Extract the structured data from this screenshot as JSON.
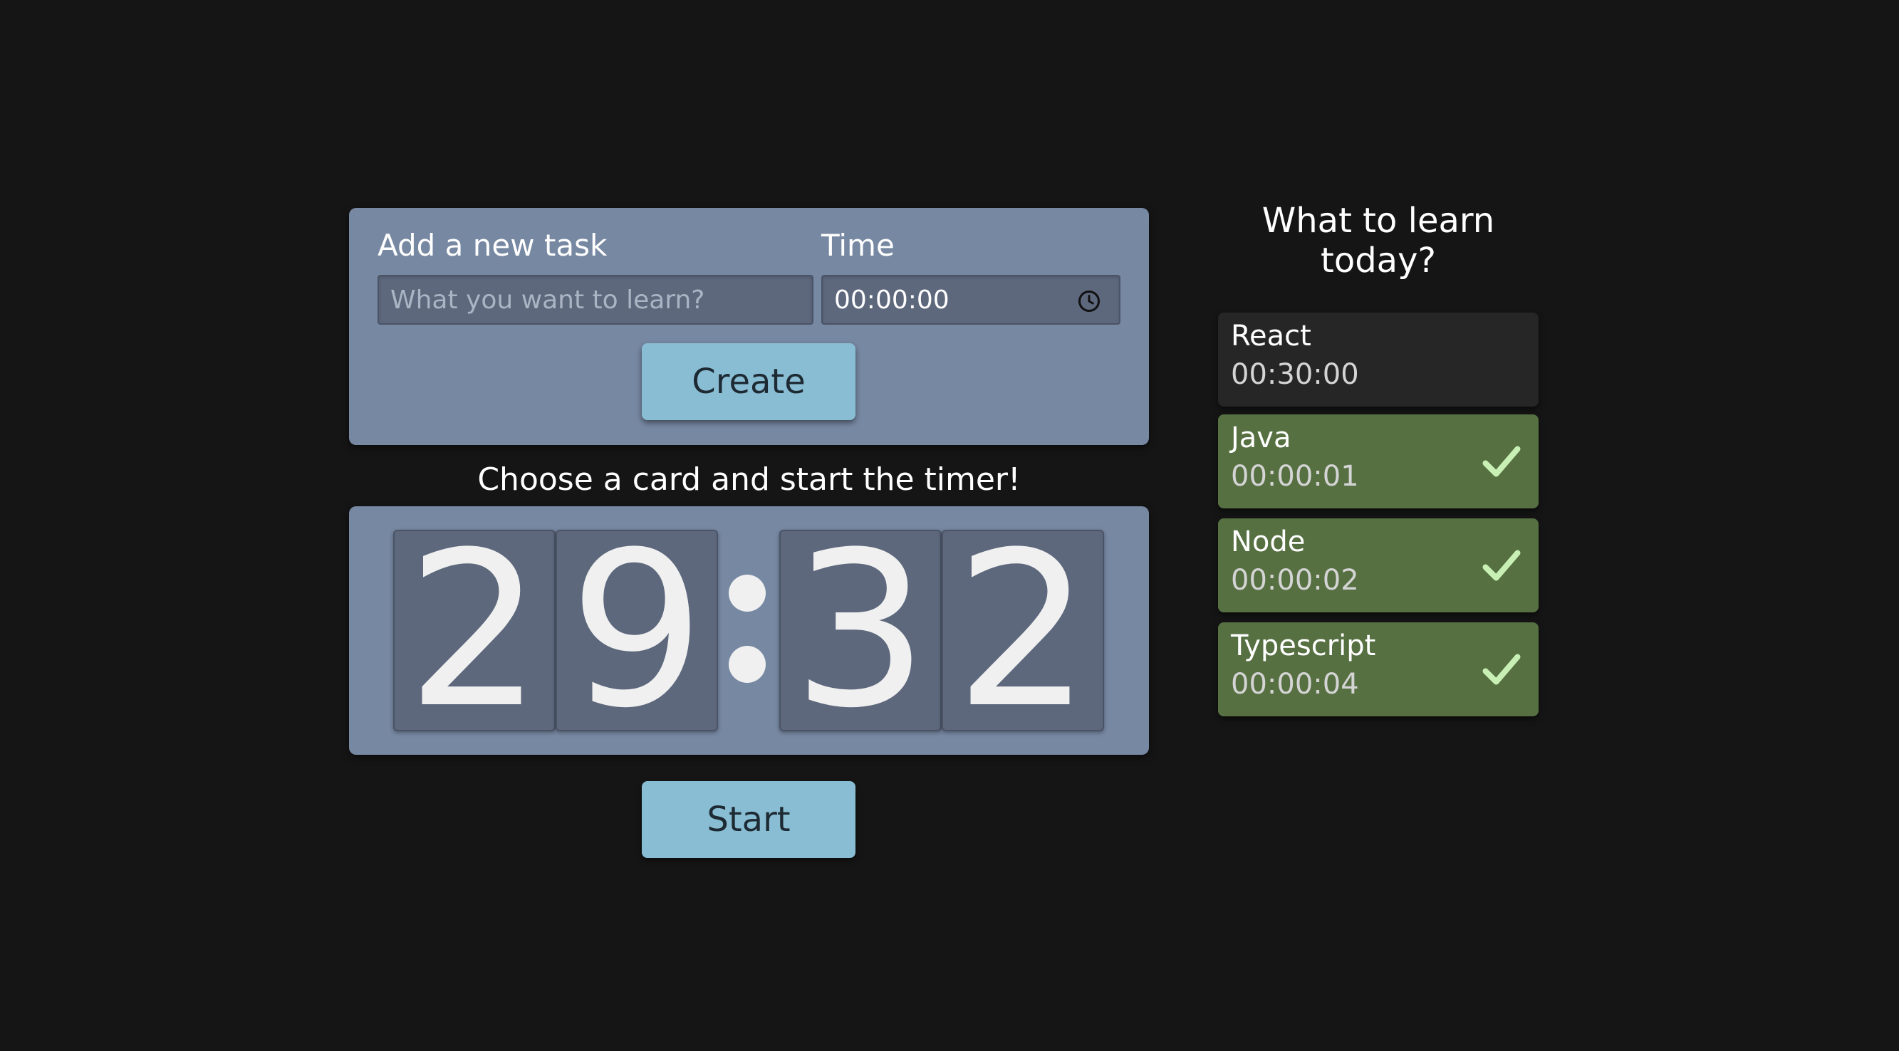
{
  "form": {
    "task_label": "Add a new task",
    "task_placeholder": "What you want to learn?",
    "time_label": "Time",
    "time_value": "00:00:00",
    "time_icon": "clock-icon",
    "create_label": "Create"
  },
  "timer": {
    "caption": "Choose a card and start the timer!",
    "digits": [
      "2",
      "9",
      "3",
      "2"
    ],
    "start_label": "Start"
  },
  "sidebar": {
    "title": "What to learn today?",
    "tasks": [
      {
        "name": "React",
        "time": "00:30:00",
        "completed": false
      },
      {
        "name": "Java",
        "time": "00:00:01",
        "completed": true,
        "icon": "check-icon"
      },
      {
        "name": "Node",
        "time": "00:00:02",
        "completed": true,
        "icon": "check-icon"
      },
      {
        "name": "Typescript",
        "time": "00:00:04",
        "completed": true,
        "icon": "check-icon"
      }
    ]
  },
  "colors": {
    "background": "#151515",
    "panel": "#7788a2",
    "panel_inset": "#5d687d",
    "button": "#89bdd3",
    "card_pending": "#262626",
    "card_done": "#567042",
    "check": "#c8f0b4"
  }
}
